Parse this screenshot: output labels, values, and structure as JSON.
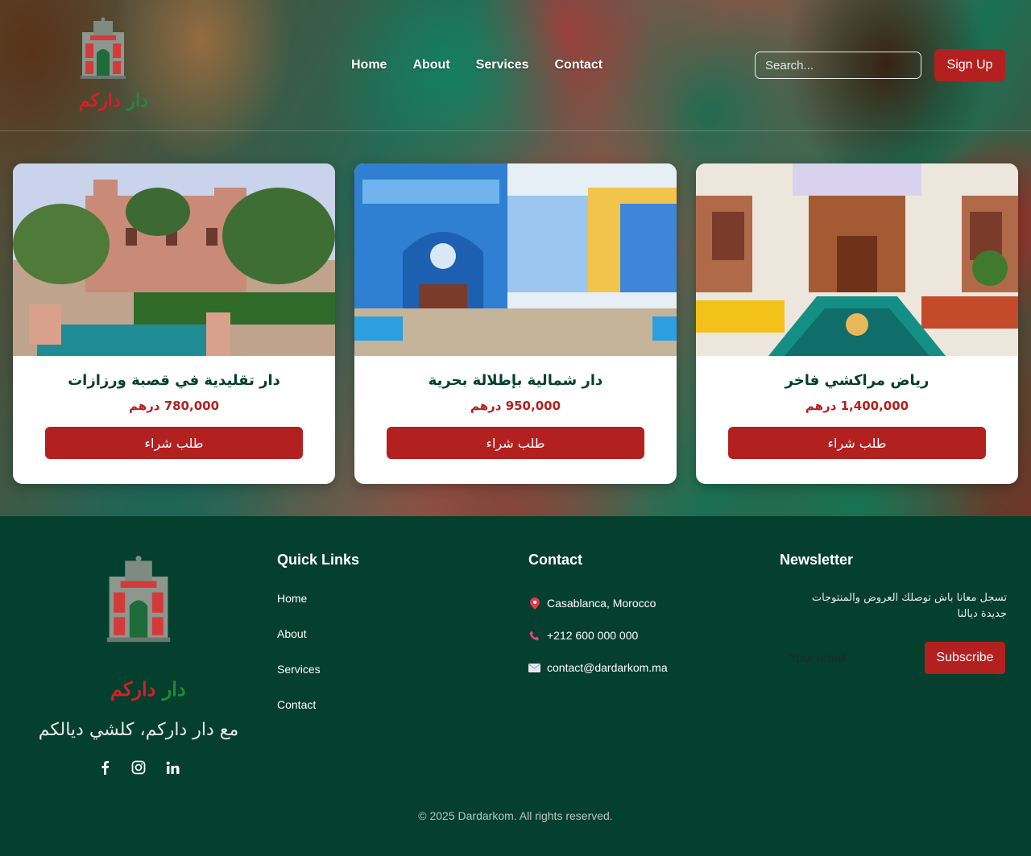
{
  "header": {
    "brand": {
      "part1": "دار",
      "part2": "داركم"
    },
    "nav": [
      {
        "label": "Home"
      },
      {
        "label": "About"
      },
      {
        "label": "Services"
      },
      {
        "label": "Contact"
      }
    ],
    "search_placeholder": "Search...",
    "signup_label": "Sign Up"
  },
  "cards": [
    {
      "title": "دار تقليدية في قصبة ورزازات",
      "price": "780,000 درهم",
      "button": "طلب شراء"
    },
    {
      "title": "دار شمالية بإطلالة بحرية",
      "price": "950,000 درهم",
      "button": "طلب شراء"
    },
    {
      "title": "رياض مراكشي فاخر",
      "price": "1,400,000 درهم",
      "button": "طلب شراء"
    }
  ],
  "footer": {
    "brand": {
      "part1": "دار",
      "part2": "داركم"
    },
    "tagline": "مع دار داركم، كلشي ديالكم",
    "social": [
      "facebook-icon",
      "instagram-icon",
      "linkedin-icon"
    ],
    "quick_links": {
      "title": "Quick Links",
      "items": [
        "Home",
        "About",
        "Services",
        "Contact"
      ]
    },
    "contact": {
      "title": "Contact",
      "address": "Casablanca, Morocco",
      "phone": "+212 600 000 000",
      "email": "contact@dardarkom.ma"
    },
    "newsletter": {
      "title": "Newsletter",
      "text_line1": "تسجل معانا باش توصلك العروض والمنتوجات",
      "text_line2": "جديدة ديالنا",
      "placeholder": "Your email",
      "button": "Subscribe"
    },
    "copyright": "© 2025 Dardarkom. All rights reserved."
  },
  "colors": {
    "primary_green": "#04402d",
    "accent_red": "#b32020",
    "brand_green": "#1f8a3a",
    "brand_red": "#d3202a"
  }
}
